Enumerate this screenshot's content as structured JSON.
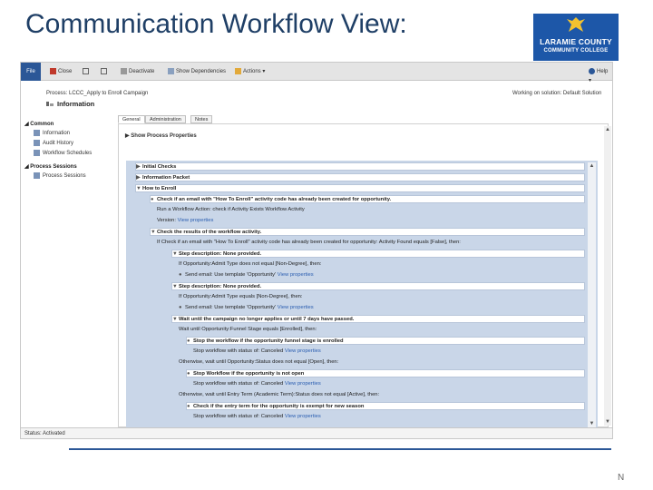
{
  "slide": {
    "title": "Communication Workflow View:",
    "logo_line1": "LARAMIE COUNTY",
    "logo_line2": "COMMUNITY COLLEGE",
    "page_number": "N"
  },
  "ribbon": {
    "file_label": "File",
    "save_close_label": "Close",
    "deactivate_label": "Deactivate",
    "show_dependencies_label": "Show Dependencies",
    "actions_label": "Actions",
    "help_label": "Help"
  },
  "header": {
    "breadcrumb": "Process: LCCC_Apply to Enroll Campaign",
    "info_title": "Information",
    "working_solution": "Working on solution: Default Solution"
  },
  "nav": {
    "common_label": "Common",
    "common_items": [
      "Information",
      "Audit History",
      "Workflow Schedules"
    ],
    "sessions_label": "Process Sessions",
    "sessions_items": [
      "Process Sessions"
    ]
  },
  "tabs": [
    "General",
    "Administration",
    "Notes"
  ],
  "content": {
    "show_process_properties": "Show Process Properties"
  },
  "steps": [
    {
      "text": "Initial Checks",
      "style": "bar",
      "marker": "▶"
    },
    {
      "text": "Information Packet",
      "style": "bar",
      "marker": "▶"
    },
    {
      "text": "How to Enroll",
      "style": "bar",
      "marker": "▼"
    },
    {
      "text": "Check if an email with \"How To Enroll\" activity code has already been created for opportunity.",
      "style": "bar",
      "marker": "●"
    },
    {
      "text": "Run a Workflow Action: check if Activity Exists Workflow Activity",
      "style": "plain",
      "marker": ""
    },
    {
      "text": "Version:",
      "style": "plain",
      "marker": "",
      "link": "View properties"
    },
    {
      "text": "Check the results of the workflow activity.",
      "style": "bar",
      "marker": "▼"
    },
    {
      "text": "If Check if an email with \"How To Enroll\" activity code has already been created for opportunity: Activity Found equals [False], then:",
      "style": "plain",
      "marker": ""
    },
    {
      "text": "Step description: None provided.",
      "style": "bar",
      "marker": "▼"
    },
    {
      "text": "If Opportunity:Admit Type does not equal [Non-Degree], then:",
      "style": "plain",
      "marker": ""
    },
    {
      "text": "Send email: Use template 'Opportunity'",
      "style": "plain",
      "marker": "●",
      "link": "View properties"
    },
    {
      "text": "Step description: None provided.",
      "style": "bar",
      "marker": "▼"
    },
    {
      "text": "If Opportunity:Admit Type equals [Non-Degree], then:",
      "style": "plain",
      "marker": ""
    },
    {
      "text": "Send email: Use template 'Opportunity'",
      "style": "plain",
      "marker": "●",
      "link": "View properties"
    },
    {
      "text": "Wait until the campaign no longer applies or until 7 days have passed.",
      "style": "bar",
      "marker": "▼"
    },
    {
      "text": "Wait until Opportunity:Funnel Stage equals [Enrolled], then:",
      "style": "plain",
      "marker": ""
    },
    {
      "text": "Stop the workflow if the opportunity funnel stage is enrolled",
      "style": "bar",
      "marker": "●"
    },
    {
      "text": "Stop workflow with status of: Canceled",
      "style": "plain",
      "marker": "",
      "link": "View properties"
    },
    {
      "text": "Otherwise, wait until Opportunity:Status does not equal [Open], then:",
      "style": "plain",
      "marker": ""
    },
    {
      "text": "Stop Workflow if the opportunity is not open",
      "style": "bar",
      "marker": "●"
    },
    {
      "text": "Stop workflow with status of: Canceled",
      "style": "plain",
      "marker": "",
      "link": "View properties"
    },
    {
      "text": "Otherwise, wait until Entry Term (Academic Term):Status does not equal [Active], then:",
      "style": "plain",
      "marker": ""
    },
    {
      "text": "Check if the entry term for the opportunity is exempt for new season",
      "style": "bar",
      "marker": "●"
    },
    {
      "text": "Stop workflow with status of: Canceled",
      "style": "plain",
      "marker": "",
      "link": "View properties"
    }
  ],
  "status_bar": "Status: Activated",
  "colors": {
    "title_blue": "#1f3f66",
    "logo_blue": "#1d57a8",
    "steps_background": "#c9d6e8",
    "rule_blue": "#2b5797"
  }
}
